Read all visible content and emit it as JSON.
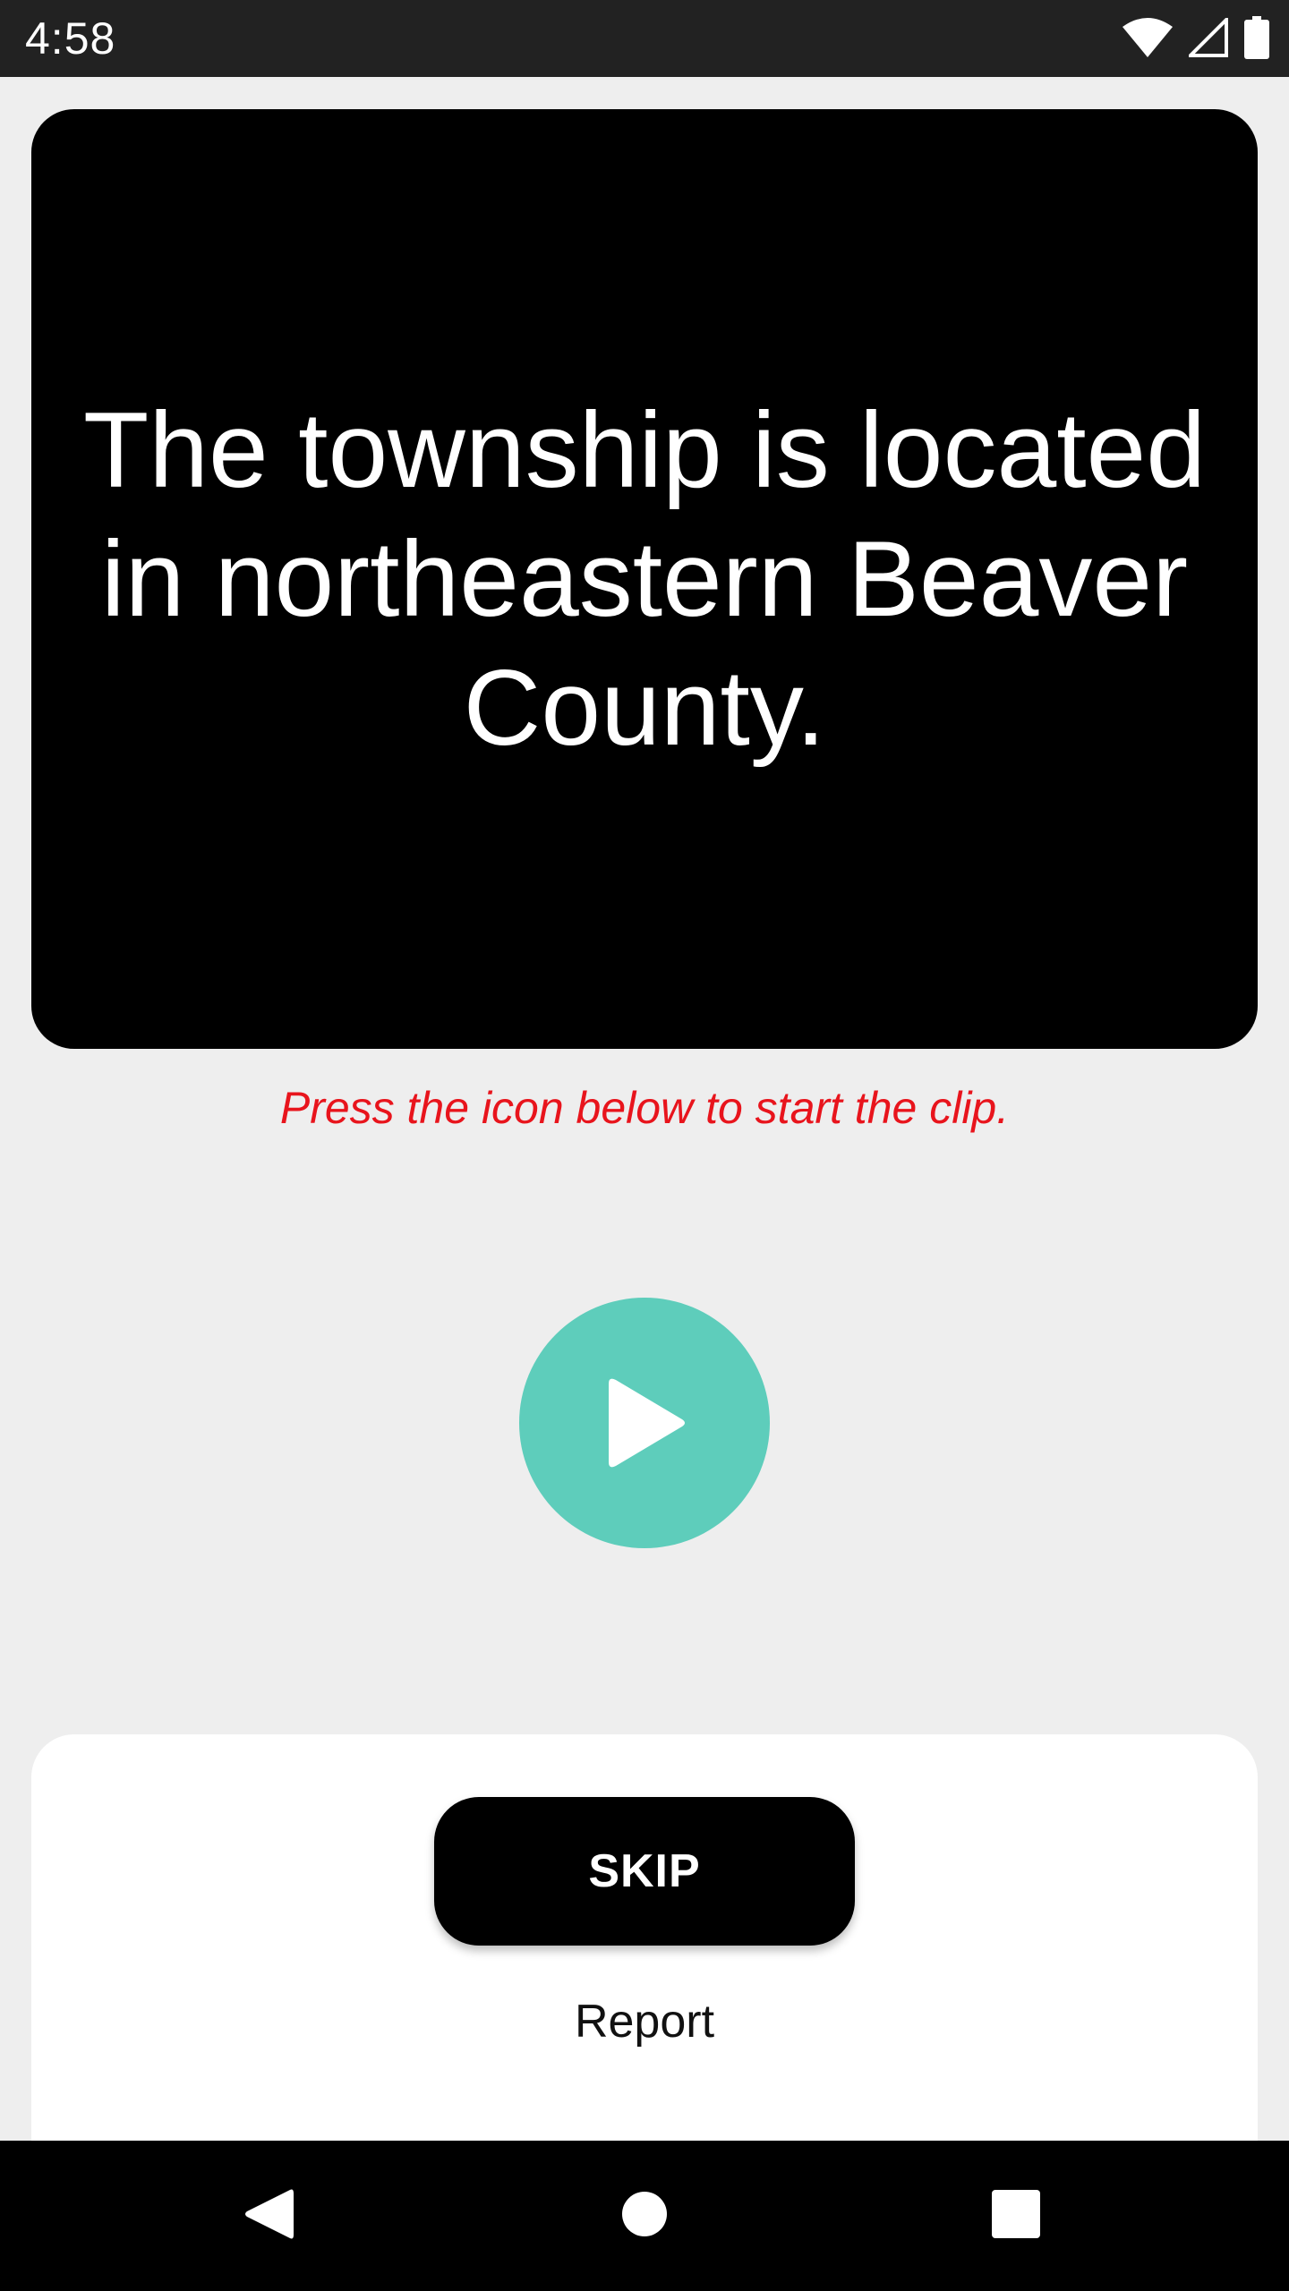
{
  "status_bar": {
    "time": "4:58",
    "icons": [
      "wifi-icon",
      "signal-icon",
      "battery-icon"
    ]
  },
  "sentence": {
    "text": "The township is located in northeastern Beaver County."
  },
  "instruction": {
    "text": "Press the icon below to start the clip."
  },
  "play_button": {
    "icon": "play-icon",
    "color": "#5ecdbb"
  },
  "actions": {
    "skip_label": "SKIP",
    "report_label": "Report"
  },
  "nav_bar": {
    "icons": [
      "back-icon",
      "home-icon",
      "recents-icon"
    ]
  },
  "colors": {
    "instruction_text": "#e8141c",
    "card_background": "#000000",
    "page_background": "#eeeeee"
  }
}
